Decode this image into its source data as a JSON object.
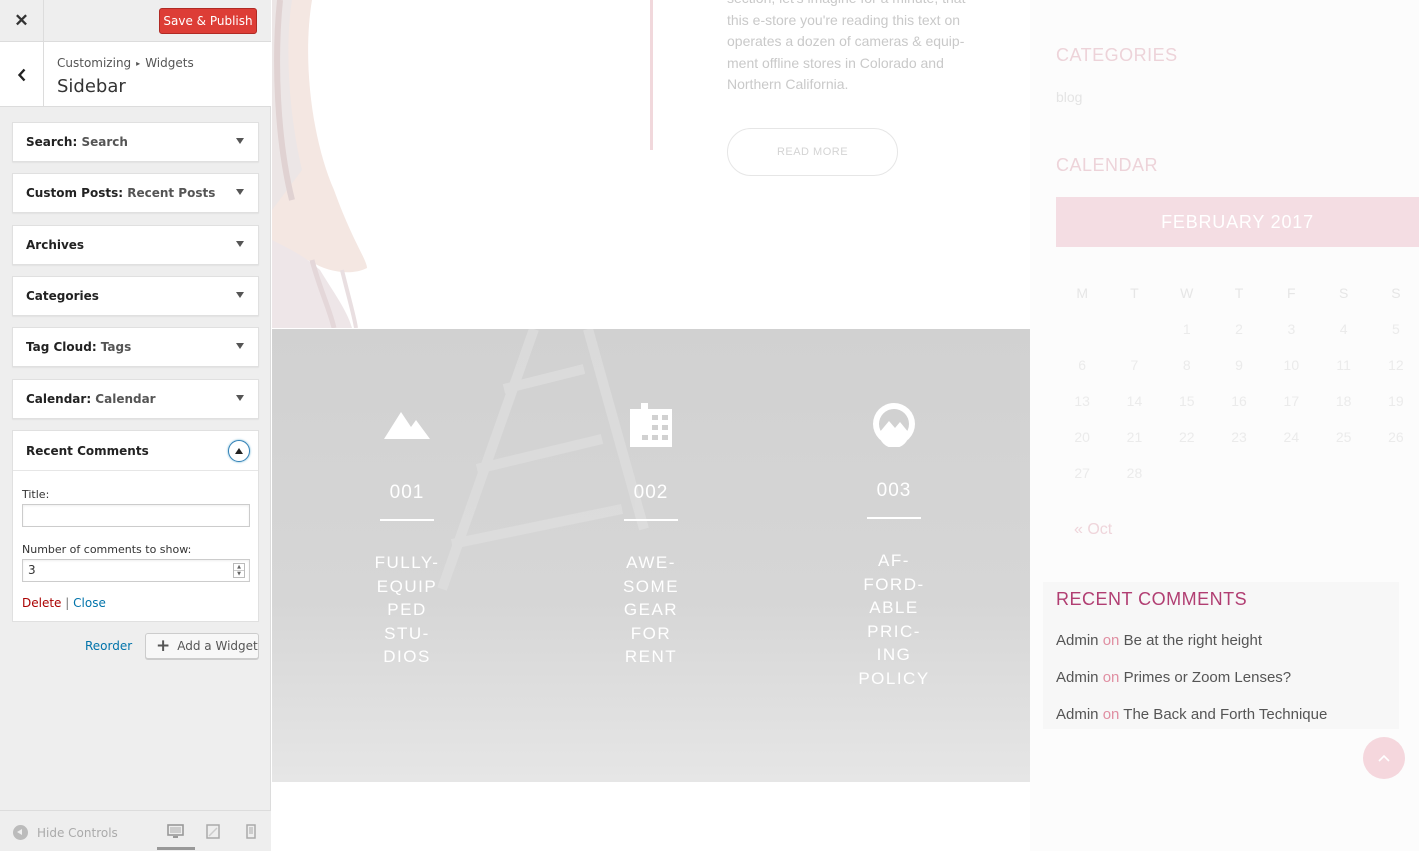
{
  "panel": {
    "close_label": "✕",
    "publish_label": "Save & Publish",
    "breadcrumb_root": "Customizing",
    "breadcrumb_current": "Widgets",
    "section_title": "Sidebar",
    "widgets": [
      {
        "type": "Search",
        "title": "Search"
      },
      {
        "type": "Custom Posts",
        "title": "Recent Posts"
      },
      {
        "type": "Archives",
        "title": ""
      },
      {
        "type": "Categories",
        "title": ""
      },
      {
        "type": "Tag Cloud",
        "title": "Tags"
      },
      {
        "type": "Calendar",
        "title": "Calendar"
      }
    ],
    "open_widget": {
      "title": "Recent Comments",
      "title_label": "Title:",
      "title_value": "",
      "count_label": "Number of comments to show:",
      "count_value": "3",
      "delete_label": "Delete",
      "separator": "|",
      "close_label": "Close"
    },
    "reorder_label": "Reorder",
    "add_widget_label": "Add a Widget",
    "hide_controls_label": "Hide Controls"
  },
  "preview": {
    "hero_text": [
      "section, let's imagine for a minute, that",
      "this e-store you're reading this text on",
      "operates a dozen of cameras & equip-",
      "ment offline stores in Colorado and",
      "Northern California."
    ],
    "read_more_label": "READ MORE",
    "features": [
      {
        "number": "001",
        "label": [
          "FULLY-",
          "EQUIP",
          "PED",
          "STU-",
          "DIOS"
        ],
        "icon": "mountain-icon"
      },
      {
        "number": "002",
        "label": [
          "AWE-",
          "SOME",
          "GEAR",
          "FOR",
          "RENT"
        ],
        "icon": "film-icon"
      },
      {
        "number": "003",
        "label": [
          "AF-",
          "FORD-",
          "ABLE",
          "PRIC-",
          "ING",
          "POLICY"
        ],
        "icon": "circle-mountain-icon"
      }
    ],
    "sidebar": {
      "categories_title": "CATEGORIES",
      "categories": [
        "blog"
      ],
      "calendar_title": "CALENDAR",
      "calendar_month": "FEBRUARY 2017",
      "day_headers": [
        "M",
        "T",
        "W",
        "T",
        "F",
        "S",
        "S"
      ],
      "weeks": [
        [
          "",
          "",
          "1",
          "2",
          "3",
          "4",
          "5"
        ],
        [
          "6",
          "7",
          "8",
          "9",
          "10",
          "11",
          "12"
        ],
        [
          "13",
          "14",
          "15",
          "16",
          "17",
          "18",
          "19"
        ],
        [
          "20",
          "21",
          "22",
          "23",
          "24",
          "25",
          "26"
        ],
        [
          "27",
          "28",
          "",
          "",
          "",
          "",
          ""
        ]
      ],
      "prev_link": "« Oct",
      "recent_comments_title": "RECENT COMMENTS",
      "recent_comments": [
        {
          "author": "Admin",
          "on": "on",
          "post": "Be at the right height"
        },
        {
          "author": "Admin",
          "on": "on",
          "post": "Primes or Zoom Lenses?"
        },
        {
          "author": "Admin",
          "on": "on",
          "post": "The Back and Forth Technique"
        }
      ]
    }
  },
  "colors": {
    "publish": "#dd3d36",
    "link": "#0073aa",
    "delete": "#aa0000",
    "accent_pink": "#b13e72"
  }
}
